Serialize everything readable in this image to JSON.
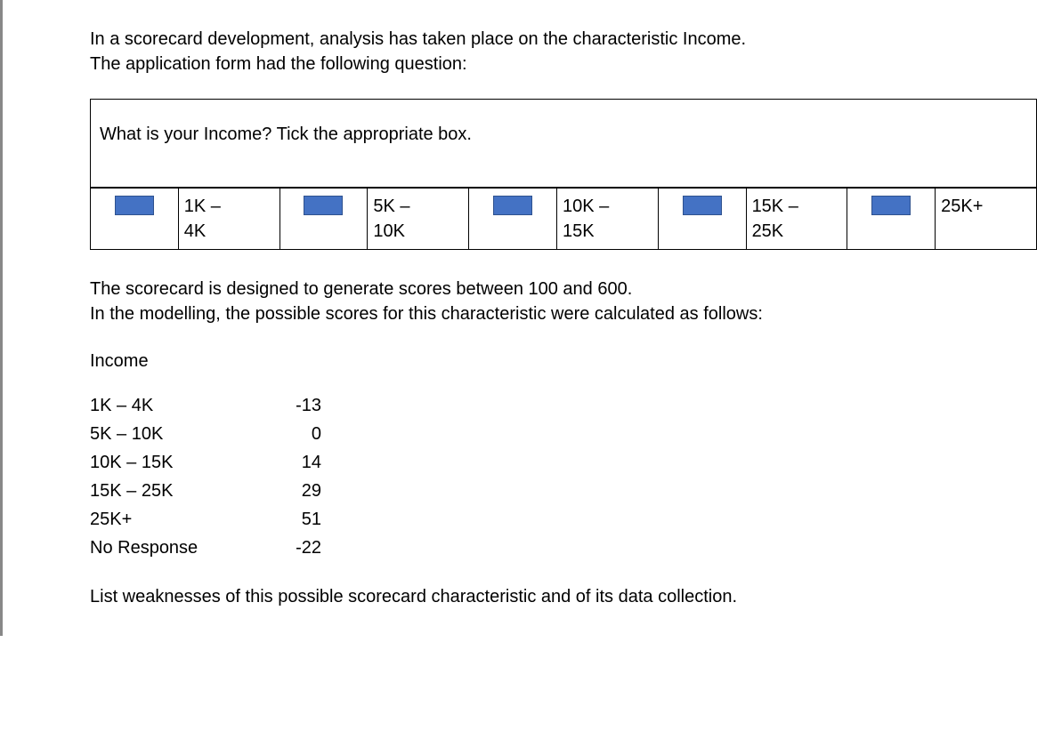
{
  "intro": {
    "line1": "In a scorecard development, analysis has taken place on the characteristic Income.",
    "line2": "The application form had the following question:"
  },
  "question": "What is your Income? Tick the appropriate box.",
  "options": [
    {
      "line1": "1K –",
      "line2": "4K"
    },
    {
      "line1": "5K –",
      "line2": "10K"
    },
    {
      "line1": "10K –",
      "line2": "15K"
    },
    {
      "line1": "15K –",
      "line2": "25K"
    },
    {
      "line1": "25K+",
      "line2": ""
    }
  ],
  "after": {
    "line1": "The scorecard is designed to generate scores between 100 and 600.",
    "line2": "In the modelling, the possible scores for this characteristic were calculated as follows:"
  },
  "income_heading": "Income",
  "scores": [
    {
      "category": "1K – 4K",
      "value": "-13"
    },
    {
      "category": "5K – 10K",
      "value": "0"
    },
    {
      "category": "10K – 15K",
      "value": "14"
    },
    {
      "category": "15K – 25K",
      "value": "29"
    },
    {
      "category": "25K+",
      "value": "51"
    },
    {
      "category": "No Response",
      "value": "-22"
    }
  ],
  "task": "List weaknesses of this possible scorecard characteristic and of its data collection."
}
